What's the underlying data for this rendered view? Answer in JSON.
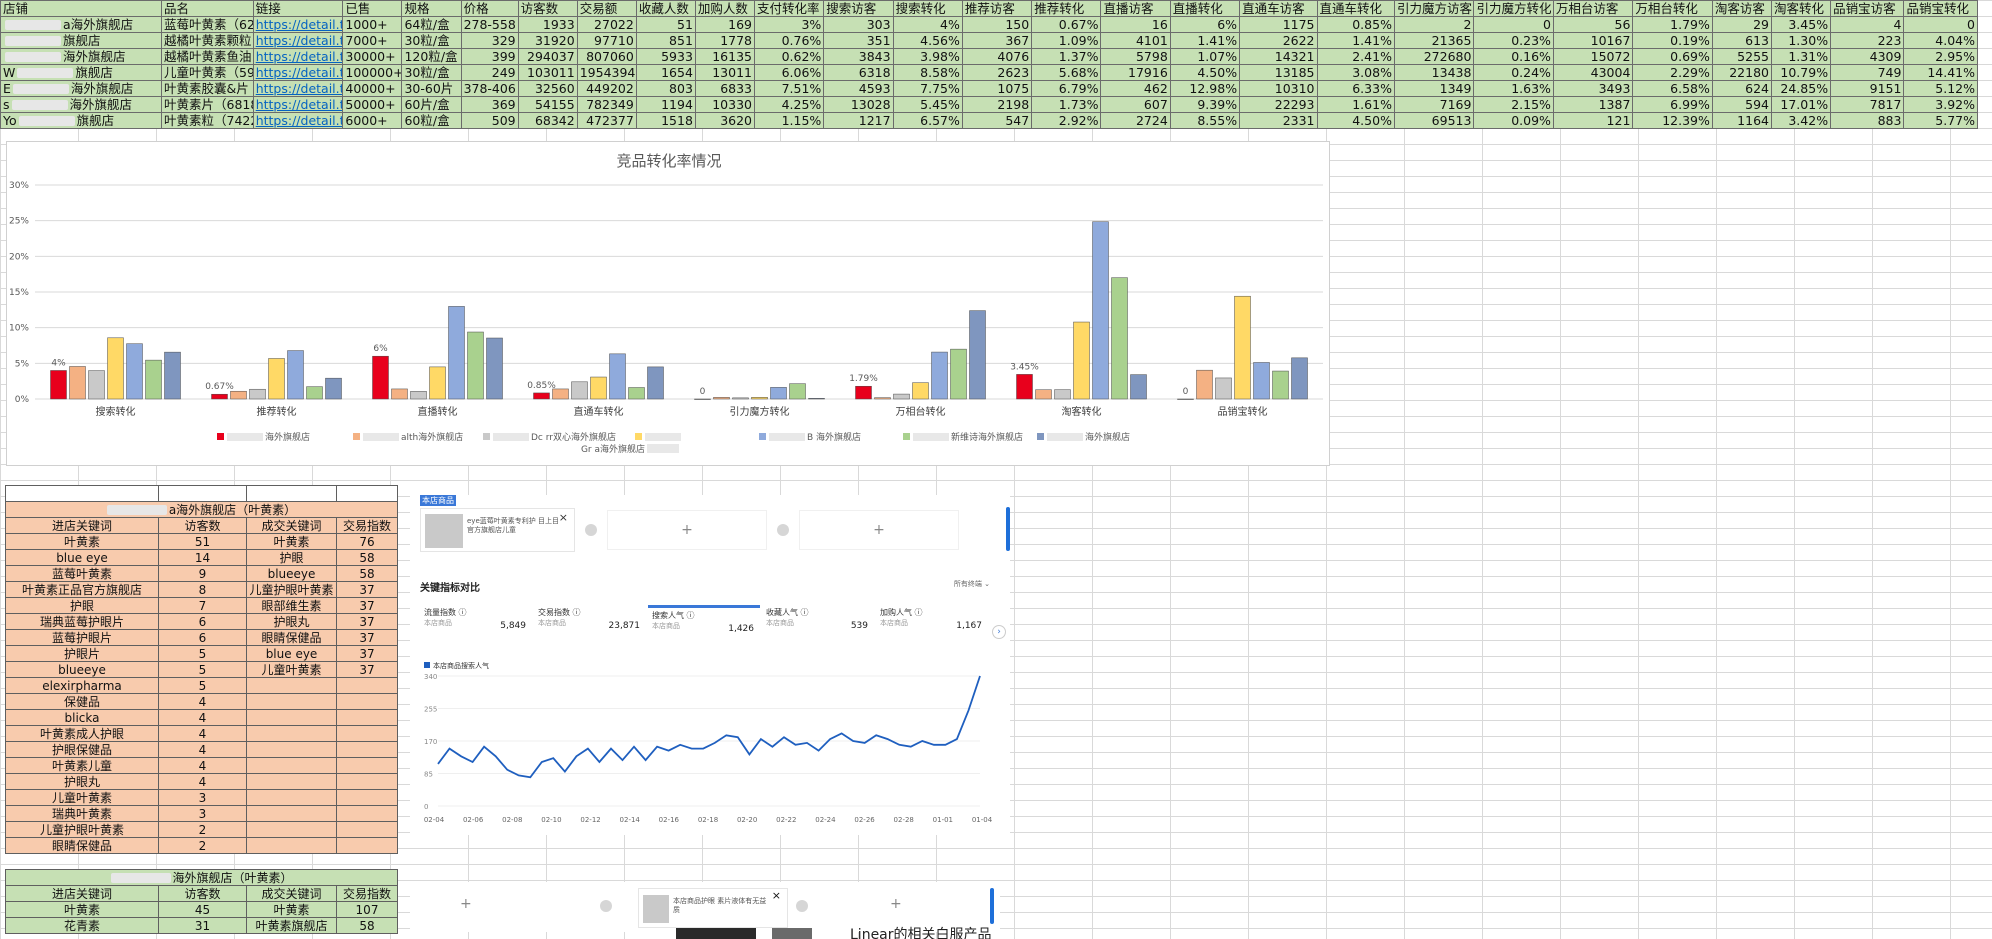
{
  "top_table": {
    "headers": [
      "店铺",
      "品名",
      "链接",
      "已售",
      "规格",
      "价格",
      "访客数",
      "交易额",
      "收藏人数",
      "加购人数",
      "支付转化率",
      "搜索访客",
      "搜索转化",
      "推荐访客",
      "推荐转化",
      "直播访客",
      "直播转化",
      "直通车访客",
      "直通车转化",
      "引力魔方访客",
      "引力魔方转化",
      "万相台访客",
      "万相台转化",
      "淘客访客",
      "淘客转化",
      "品销宝访客",
      "品销宝转化"
    ],
    "rows": [
      [
        "a海外旗舰店",
        "蓝莓叶黄素（62",
        "https://detail.tm",
        "1000+",
        "64粒/盒",
        "278-558",
        "1933",
        "27022",
        "51",
        "169",
        "3%",
        "303",
        "4%",
        "150",
        "0.67%",
        "16",
        "6%",
        "1175",
        "0.85%",
        "2",
        "0",
        "56",
        "1.79%",
        "29",
        "3.45%",
        "4",
        "0"
      ],
      [
        "旗舰店",
        "越橘叶黄素颗粒",
        "https://detail.tm",
        "7000+",
        "30粒/盒",
        "329",
        "31920",
        "97710",
        "851",
        "1778",
        "0.76%",
        "351",
        "4.56%",
        "367",
        "1.09%",
        "4101",
        "1.41%",
        "2622",
        "1.41%",
        "21365",
        "0.23%",
        "10167",
        "0.19%",
        "613",
        "1.30%",
        "223",
        "4.04%"
      ],
      [
        "海外旗舰店",
        "越橘叶黄素鱼油",
        "https://detail.tm",
        "30000+",
        "120粒/盒",
        "399",
        "294037",
        "807060",
        "5933",
        "16135",
        "0.62%",
        "3843",
        "3.98%",
        "4076",
        "1.37%",
        "5798",
        "1.07%",
        "14321",
        "2.41%",
        "272680",
        "0.16%",
        "15072",
        "0.69%",
        "5255",
        "1.31%",
        "4309",
        "2.95%"
      ],
      [
        "旗舰店",
        "儿童叶黄素（59",
        "https://detail.tm",
        "100000+",
        "30粒/盒",
        "249",
        "103011",
        "1954394",
        "1654",
        "13011",
        "6.06%",
        "6318",
        "8.58%",
        "2623",
        "5.68%",
        "17916",
        "4.50%",
        "13185",
        "3.08%",
        "13438",
        "0.24%",
        "43004",
        "2.29%",
        "22180",
        "10.79%",
        "749",
        "14.41%"
      ],
      [
        "海外旗舰店",
        "叶黄素胶囊&片",
        "https://detail.tm",
        "40000+",
        "30-60片",
        "378-406",
        "32560",
        "449202",
        "803",
        "6833",
        "7.51%",
        "4593",
        "7.75%",
        "1075",
        "6.79%",
        "462",
        "12.98%",
        "10310",
        "6.33%",
        "1349",
        "1.63%",
        "3493",
        "6.58%",
        "624",
        "24.85%",
        "9151",
        "5.12%"
      ],
      [
        "海外旗舰店",
        "叶黄素片（6818",
        "https://detail.tm",
        "50000+",
        "60片/盒",
        "369",
        "54155",
        "782349",
        "1194",
        "10330",
        "4.25%",
        "13028",
        "5.45%",
        "2198",
        "1.73%",
        "607",
        "9.39%",
        "22293",
        "1.61%",
        "7169",
        "2.15%",
        "1387",
        "6.99%",
        "594",
        "17.01%",
        "7817",
        "3.92%"
      ],
      [
        "旗舰店",
        "叶黄素粒（7422",
        "https://detail.tm",
        "6000+",
        "60粒/盒",
        "509",
        "68342",
        "472377",
        "1518",
        "3620",
        "1.15%",
        "1217",
        "6.57%",
        "547",
        "2.92%",
        "2724",
        "8.55%",
        "2331",
        "4.50%",
        "69513",
        "0.09%",
        "121",
        "12.39%",
        "1164",
        "3.42%",
        "883",
        "5.77%"
      ]
    ],
    "row_prefixes": [
      "",
      "",
      "",
      "W",
      "E",
      "s",
      "Yo"
    ]
  },
  "chart_data": {
    "type": "bar",
    "title": "竞品转化率情况",
    "categories": [
      "搜索转化",
      "推荐转化",
      "直播转化",
      "直通车转化",
      "引力魔方转化",
      "万相台转化",
      "淘客转化",
      "品销宝转化"
    ],
    "ylim": [
      0,
      30
    ],
    "yticks": [
      "0%",
      "5%",
      "10%",
      "15%",
      "20%",
      "25%",
      "30%"
    ],
    "grid": true,
    "legend_position": "bottom",
    "series": [
      {
        "name": "海外旗舰店",
        "color": "#e8001c",
        "values": [
          4,
          0.67,
          6,
          0.85,
          0,
          1.79,
          3.45,
          0
        ],
        "labels": [
          "4%",
          "0.67%",
          "6%",
          "0.85%",
          "0",
          "1.79%",
          "3.45%",
          "0"
        ]
      },
      {
        "name": "alth海外旗舰店",
        "color": "#f4b183",
        "values": [
          4.56,
          1.09,
          1.41,
          1.41,
          0.23,
          0.19,
          1.3,
          4.04
        ]
      },
      {
        "name": "Dc  rr双心海外旗舰店",
        "color": "#c9c9c9",
        "values": [
          3.98,
          1.37,
          1.07,
          2.41,
          0.16,
          0.69,
          1.31,
          2.95
        ]
      },
      {
        "name": "",
        "color": "#ffd966",
        "values": [
          8.58,
          5.68,
          4.5,
          3.08,
          0.24,
          2.29,
          10.79,
          14.41
        ]
      },
      {
        "name": "B  海外旗舰店",
        "color": "#8faadc",
        "values": [
          7.75,
          6.79,
          12.98,
          6.33,
          1.63,
          6.58,
          24.85,
          5.12
        ]
      },
      {
        "name": "新维诗海外旗舰店",
        "color": "#a9d18e",
        "values": [
          5.45,
          1.73,
          9.39,
          1.61,
          2.15,
          6.99,
          17.01,
          3.92
        ]
      },
      {
        "name": "海外旗舰店",
        "color": "#7f96bf",
        "values": [
          6.57,
          2.92,
          8.55,
          4.5,
          0.09,
          12.39,
          3.42,
          5.77
        ]
      }
    ],
    "extra_legend": "Gr  a海外旗舰店"
  },
  "kw_table_1": {
    "title": "a海外旗舰店（叶黄素）",
    "headers": [
      "进店关键词",
      "访客数",
      "成交关键词",
      "交易指数"
    ],
    "rows": [
      [
        "叶黄素",
        "51",
        "叶黄素",
        "76"
      ],
      [
        "blue eye",
        "14",
        "护眼",
        "58"
      ],
      [
        "蓝莓叶黄素",
        "9",
        "blueeye",
        "58"
      ],
      [
        "叶黄素正品官方旗舰店",
        "8",
        "儿童护眼叶黄素",
        "37"
      ],
      [
        "护眼",
        "7",
        "眼部维生素",
        "37"
      ],
      [
        "瑞典蓝莓护眼片",
        "6",
        "护眼丸",
        "37"
      ],
      [
        "蓝莓护眼片",
        "6",
        "眼睛保健品",
        "37"
      ],
      [
        "护眼片",
        "5",
        "blue eye",
        "37"
      ],
      [
        "blueeye",
        "5",
        "儿童叶黄素",
        "37"
      ],
      [
        "elexirpharma",
        "5",
        "",
        ""
      ],
      [
        "保健品",
        "4",
        "",
        ""
      ],
      [
        "blicka",
        "4",
        "",
        ""
      ],
      [
        "叶黄素成人护眼",
        "4",
        "",
        ""
      ],
      [
        "护眼保健品",
        "4",
        "",
        ""
      ],
      [
        "叶黄素儿童",
        "4",
        "",
        ""
      ],
      [
        "护眼丸",
        "4",
        "",
        ""
      ],
      [
        "儿童叶黄素",
        "3",
        "",
        ""
      ],
      [
        "瑞典叶黄素",
        "3",
        "",
        ""
      ],
      [
        "儿童护眼叶黄素",
        "2",
        "",
        ""
      ],
      [
        "眼睛保健品",
        "2",
        "",
        ""
      ]
    ]
  },
  "kw_table_2": {
    "title": "海外旗舰店（叶黄素）",
    "headers": [
      "进店关键词",
      "访客数",
      "成交关键词",
      "交易指数"
    ],
    "rows": [
      [
        "叶黄素",
        "45",
        "叶黄素",
        "107"
      ],
      [
        "花青素",
        "31",
        "叶黄素旗舰店",
        "58"
      ]
    ]
  },
  "panel": {
    "tag": "本店商品",
    "card_text": "eye蓝莓叶黄素专利护  目上目官方旗舰店儿童",
    "close": "×",
    "add": "+",
    "metrics_title": "关键指标对比",
    "metrics_filter": "所有终端 ⌄",
    "metrics": [
      {
        "label": "流量指数 ⓘ",
        "sub": "本店商品",
        "value": "5,849"
      },
      {
        "label": "交易指数 ⓘ",
        "sub": "本店商品",
        "value": "23,871"
      },
      {
        "label": "搜索人气 ⓘ",
        "sub": "本店商品",
        "value": "1,426"
      },
      {
        "label": "收藏人气 ⓘ",
        "sub": "本店商品",
        "value": "539"
      },
      {
        "label": "加购人气 ⓘ",
        "sub": "本店商品",
        "value": "1,167"
      }
    ],
    "next": "›",
    "legend": "本店商品搜索人气",
    "line_yticks": [
      "340",
      "255",
      "170",
      "85",
      "0"
    ],
    "line_xticks": [
      "02-04",
      "02-06",
      "02-08",
      "02-10",
      "02-12",
      "02-14",
      "02-16",
      "02-18",
      "02-20",
      "02-22",
      "02-24",
      "02-26",
      "02-28",
      "01-01",
      "01-04"
    ],
    "line_values": [
      110,
      150,
      130,
      115,
      155,
      130,
      95,
      80,
      75,
      115,
      125,
      90,
      130,
      150,
      115,
      150,
      120,
      155,
      120,
      155,
      145,
      160,
      150,
      150,
      165,
      185,
      180,
      135,
      175,
      155,
      180,
      160,
      165,
      145,
      175,
      190,
      170,
      165,
      185,
      175,
      160,
      155,
      170,
      160,
      160,
      175,
      250,
      340
    ]
  },
  "panel2": {
    "add": "+",
    "card_text": "本店商品护眼 素片液体有无益质",
    "close": "×"
  },
  "bottom_text": "Linear的相关白服产品"
}
